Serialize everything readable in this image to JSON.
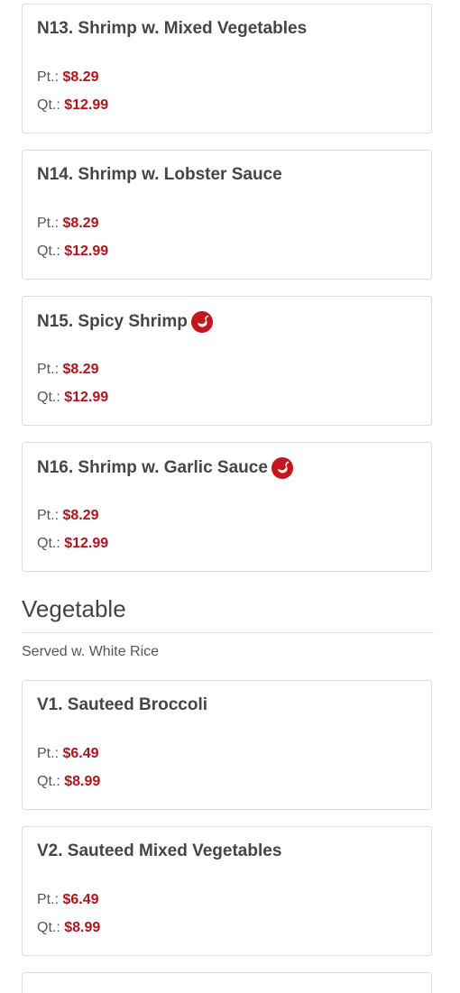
{
  "items_top": [
    {
      "name": "N13. Shrimp w. Mixed Vegetables",
      "spicy": false,
      "pt_label": "Pt.:",
      "pt": "$8.29",
      "qt_label": "Qt.:",
      "qt": "$12.99"
    },
    {
      "name": "N14. Shrimp w. Lobster Sauce",
      "spicy": false,
      "pt_label": "Pt.:",
      "pt": "$8.29",
      "qt_label": "Qt.:",
      "qt": "$12.99"
    },
    {
      "name": "N15. Spicy Shrimp",
      "spicy": true,
      "pt_label": "Pt.:",
      "pt": "$8.29",
      "qt_label": "Qt.:",
      "qt": "$12.99"
    },
    {
      "name": "N16. Shrimp w. Garlic Sauce",
      "spicy": true,
      "pt_label": "Pt.:",
      "pt": "$8.29",
      "qt_label": "Qt.:",
      "qt": "$12.99"
    }
  ],
  "section": {
    "title": "Vegetable",
    "subtitle": "Served w. White Rice"
  },
  "items_veg": [
    {
      "name": "V1. Sauteed Broccoli",
      "spicy": false,
      "pt_label": "Pt.:",
      "pt": "$6.49",
      "qt_label": "Qt.:",
      "qt": "$8.99"
    },
    {
      "name": "V2. Sauteed Mixed Vegetables",
      "spicy": false,
      "pt_label": "Pt.:",
      "pt": "$6.49",
      "qt_label": "Qt.:",
      "qt": "$8.99"
    }
  ],
  "colors": {
    "price": "#b3141a",
    "spicy_icon": "#c4161c"
  },
  "icons": {
    "spicy": "chili-pepper-icon"
  }
}
